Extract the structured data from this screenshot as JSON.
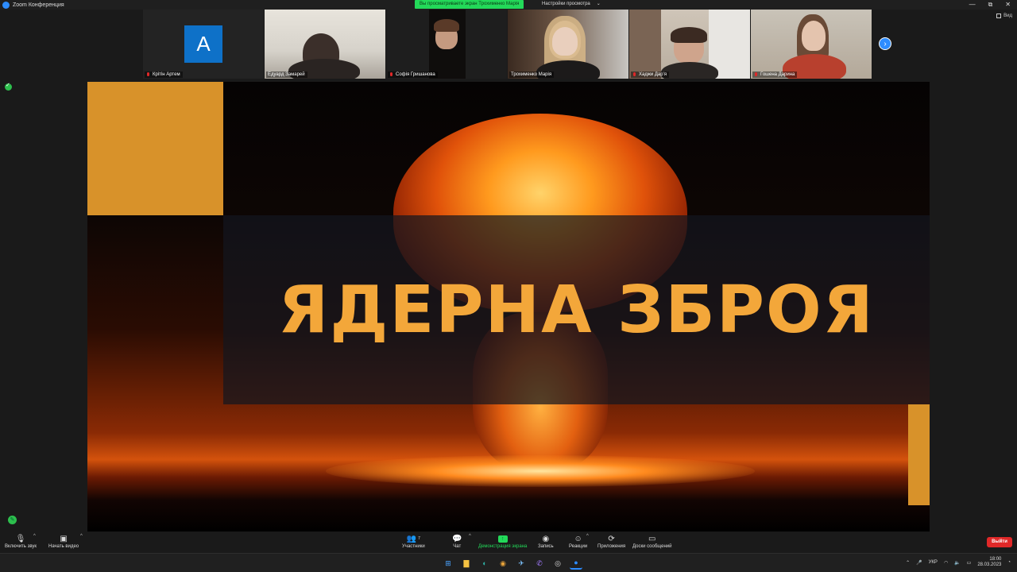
{
  "window": {
    "title": "Zoom Конференция",
    "share_banner": "Вы просматриваете экран Трохименко Марія",
    "view_options": "Настройки просмотра",
    "controls": {
      "minimize": "—",
      "restore": "⧉",
      "close": "✕"
    }
  },
  "gallery": {
    "participants": [
      {
        "name": "Крітін Артем",
        "avatar_letter": "A",
        "muted": true,
        "video": false
      },
      {
        "name": "Едуард Замарей",
        "muted": false,
        "video": true,
        "active_speaker": true
      },
      {
        "name": "Софія Гришанова",
        "muted": true,
        "video": true
      },
      {
        "name": "Трохименко Марія",
        "muted": false,
        "video": true
      },
      {
        "name": "Хаджи Дар'я",
        "muted": true,
        "video": true
      },
      {
        "name": "Гошена Дарина",
        "muted": true,
        "video": true
      }
    ],
    "view_label": "Вид"
  },
  "shared_slide": {
    "title": "ЯДЕРНА ЗБРОЯ",
    "accent_color": "#d8922a",
    "title_color": "#f3a73a"
  },
  "toolbar": {
    "audio": "Включить звук",
    "video": "Начать видео",
    "participants": "Участники",
    "participants_count": "7",
    "chat": "Чат",
    "share_screen": "Демонстрация экрана",
    "record": "Запись",
    "reactions": "Реакции",
    "apps": "Приложения",
    "whiteboards": "Доски сообщений",
    "leave": "Выйти"
  },
  "taskbar": {
    "language": "УКР",
    "time": "18:00",
    "date": "28.03.2023"
  }
}
